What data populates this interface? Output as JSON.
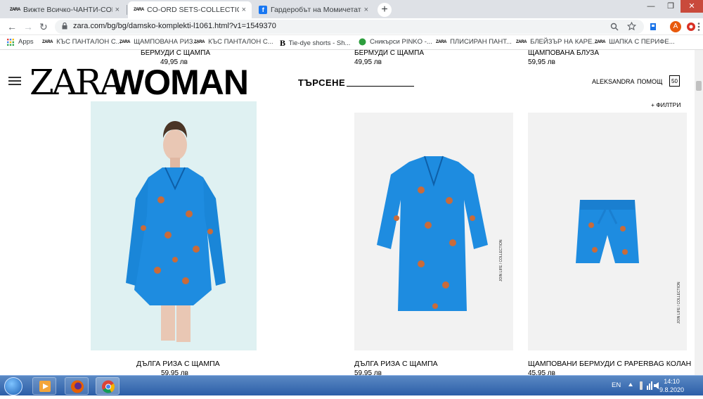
{
  "tabs": [
    {
      "favicon": "ZARA",
      "title": "Вижте Всичко-ЧАНТИ-COLLECT",
      "close": "×"
    },
    {
      "favicon": "ZARA",
      "title": "CO-ORD SETS-COLLECTION-WO",
      "close": "×"
    },
    {
      "favicon": "f",
      "title": "Гардеробът на Момичетата",
      "close": "×"
    }
  ],
  "new_tab": "+",
  "window_controls": {
    "minimize": "—",
    "maximize": "❐",
    "close": "✕"
  },
  "toolbar": {
    "back": "←",
    "forward": "→",
    "reload": "↻",
    "url": "zara.com/bg/bg/damsko-komplekti-l1061.html?v1=1549370",
    "profile_initial": "A"
  },
  "bookmarks": [
    {
      "icon": "apps-icon",
      "label": "Apps"
    },
    {
      "icon": "ZARA",
      "label": "КЪС ПАНТАЛОН С..."
    },
    {
      "icon": "ZARA",
      "label": "ЩАМПОВАНА РИЗ..."
    },
    {
      "icon": "ZARA",
      "label": "КЪС ПАНТАЛОН С..."
    },
    {
      "icon": "B",
      "label": "Tie-dye shorts - Sh..."
    },
    {
      "icon": "pinko-icon",
      "label": "Сникърси PINKO -..."
    },
    {
      "icon": "ZARA",
      "label": "ПЛИСИРАН ПАНТ..."
    },
    {
      "icon": "ZARA",
      "label": "БЛЕЙЗЪР НА КАРЕ..."
    },
    {
      "icon": "ZARA",
      "label": "ШАПКА С ПЕРИФЕ..."
    }
  ],
  "top_products": [
    {
      "title": "БЕРМУДИ С ЩАМПА",
      "price": "49,95 лв"
    },
    {
      "title": "БЕРМУДИ С ЩАМПА",
      "price": "49,95 лв"
    },
    {
      "title": "ЩАМПОВАНА БЛУЗА",
      "price": "59,95 лв"
    }
  ],
  "header": {
    "logo_zara": "ZARA",
    "logo_woman": "WOMAN",
    "search_label": "ТЪРСЕНЕ",
    "user_name": "ALEKSANDRA",
    "help": "ПОМОЩ",
    "bag_count": "50",
    "filters": "+ ФИЛТРИ"
  },
  "products": [
    {
      "title": "ДЪЛГА РИЗА С ЩАМПА",
      "price": "59,95 лв",
      "bg": "#dff1f2"
    },
    {
      "title": "ДЪЛГА РИЗА С ЩАМПА",
      "price": "59,95 лв",
      "bg": "#f2f2f2",
      "tag": "JOIN LIFE / COLLECTION"
    },
    {
      "title": "ЩАМПОВАНИ БЕРМУДИ С PAPERBAG КОЛАН",
      "price": "45,95 лв",
      "bg": "#f2f2f2",
      "tag": "JOIN LIFE / COLLECTION"
    }
  ],
  "taskbar": {
    "language": "EN",
    "time": "14:10",
    "date": "9.8.2020"
  },
  "colors": {
    "print_blue": "#1e90e0",
    "taskbar": "#2c5ea8",
    "tab_bar": "#dee1e6"
  }
}
